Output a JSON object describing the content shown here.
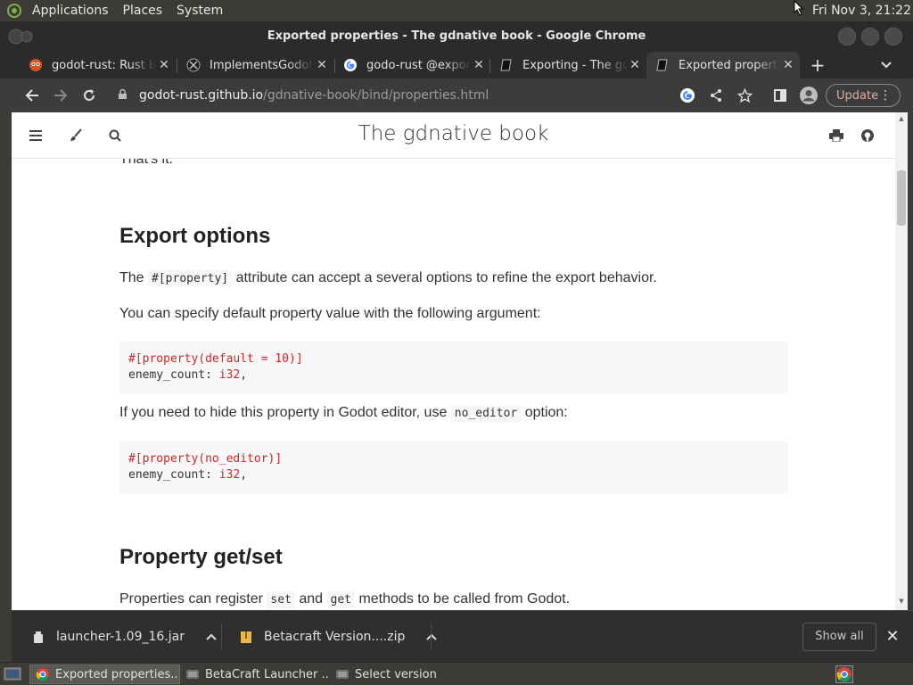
{
  "top_panel": {
    "menus": [
      "Applications",
      "Places",
      "System"
    ],
    "clock": "Fri Nov  3, 21:22"
  },
  "window": {
    "title": "Exported properties - The gdnative book - Google Chrome"
  },
  "tabs": [
    {
      "label": "godot-rust: Rust bindings",
      "favicon": "godot-rust-icon"
    },
    {
      "label": "ImplementsGodotExport",
      "favicon": "github-icon"
    },
    {
      "label": "godo-rust @export",
      "favicon": "google-icon"
    },
    {
      "label": "Exporting - The gdnative book",
      "favicon": "book-icon"
    },
    {
      "label": "Exported properties",
      "favicon": "book-icon"
    }
  ],
  "toolbar": {
    "url_host": "godot-rust.github.io",
    "url_path": "/gdnative-book/bind/properties.html",
    "update_label": "Update"
  },
  "page": {
    "book_title": "The gdnative book",
    "cut_text": "That's it.",
    "sections": [
      {
        "heading": "Export options"
      },
      {
        "heading": "Property get/set"
      }
    ],
    "p1_before": "The",
    "p1_code": "#[property]",
    "p1_after": "attribute can accept a several options to refine the export behavior.",
    "p2": "You can specify default property value with the following argument:",
    "code1_attr": "#[property(default = 10)]",
    "code1_field": "enemy_count: ",
    "code1_type": "i32",
    "code1_end": ",",
    "p3_before": "If you need to hide this property in Godot editor, use",
    "p3_code": "no_editor",
    "p3_after": "option:",
    "code2_attr": "#[property(no_editor)]",
    "code2_field": "enemy_count: ",
    "code2_type": "i32",
    "code2_end": ",",
    "p4_before": "Properties can register",
    "p4_code1": "set",
    "p4_mid": "and",
    "p4_code2": "get",
    "p4_after": "methods to be called from Godot."
  },
  "downloads": {
    "items": [
      {
        "name": "launcher-1.09_16.jar"
      },
      {
        "name": "Betacraft Version....zip"
      }
    ],
    "show_all": "Show all"
  },
  "taskbar": {
    "tasks": [
      {
        "label": "Exported properties..."
      },
      {
        "label": "BetaCraft Launcher ..."
      },
      {
        "label": "Select version"
      }
    ]
  },
  "colors": {
    "accent_update": "#e5a9a0",
    "code_attr": "#c82829",
    "panel_bg": "#3c3b37"
  }
}
